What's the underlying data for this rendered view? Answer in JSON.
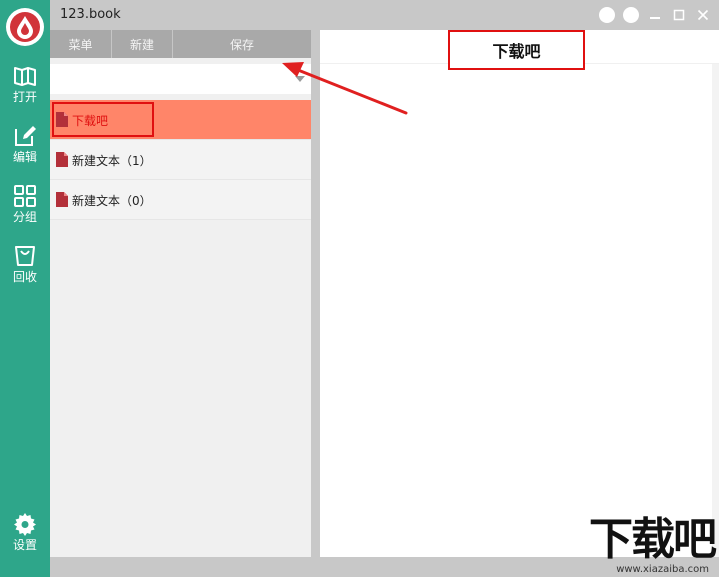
{
  "window": {
    "title": "123.book"
  },
  "sidebar": {
    "items": [
      {
        "label": "打开",
        "icon": "book-open-icon"
      },
      {
        "label": "编辑",
        "icon": "edit-icon"
      },
      {
        "label": "分组",
        "icon": "grid-icon"
      },
      {
        "label": "回收",
        "icon": "recycle-bin-icon"
      }
    ],
    "settings": {
      "label": "设置",
      "icon": "gear-icon"
    }
  },
  "toolbar": {
    "menu_label": "菜单",
    "new_label": "新建",
    "save_label": "保存"
  },
  "list": {
    "items": [
      {
        "label": "下载吧",
        "active": true
      },
      {
        "label": "新建文本（1）",
        "active": false
      },
      {
        "label": "新建文本（0）",
        "active": false
      }
    ]
  },
  "document": {
    "title": "下载吧"
  },
  "watermark": {
    "text": "下载吧",
    "url": "www.xiazaiba.com"
  },
  "colors": {
    "sidebar": "#2ea68a",
    "active_item": "#ff8569",
    "highlight": "#e01010",
    "logo": "#d1343a"
  }
}
